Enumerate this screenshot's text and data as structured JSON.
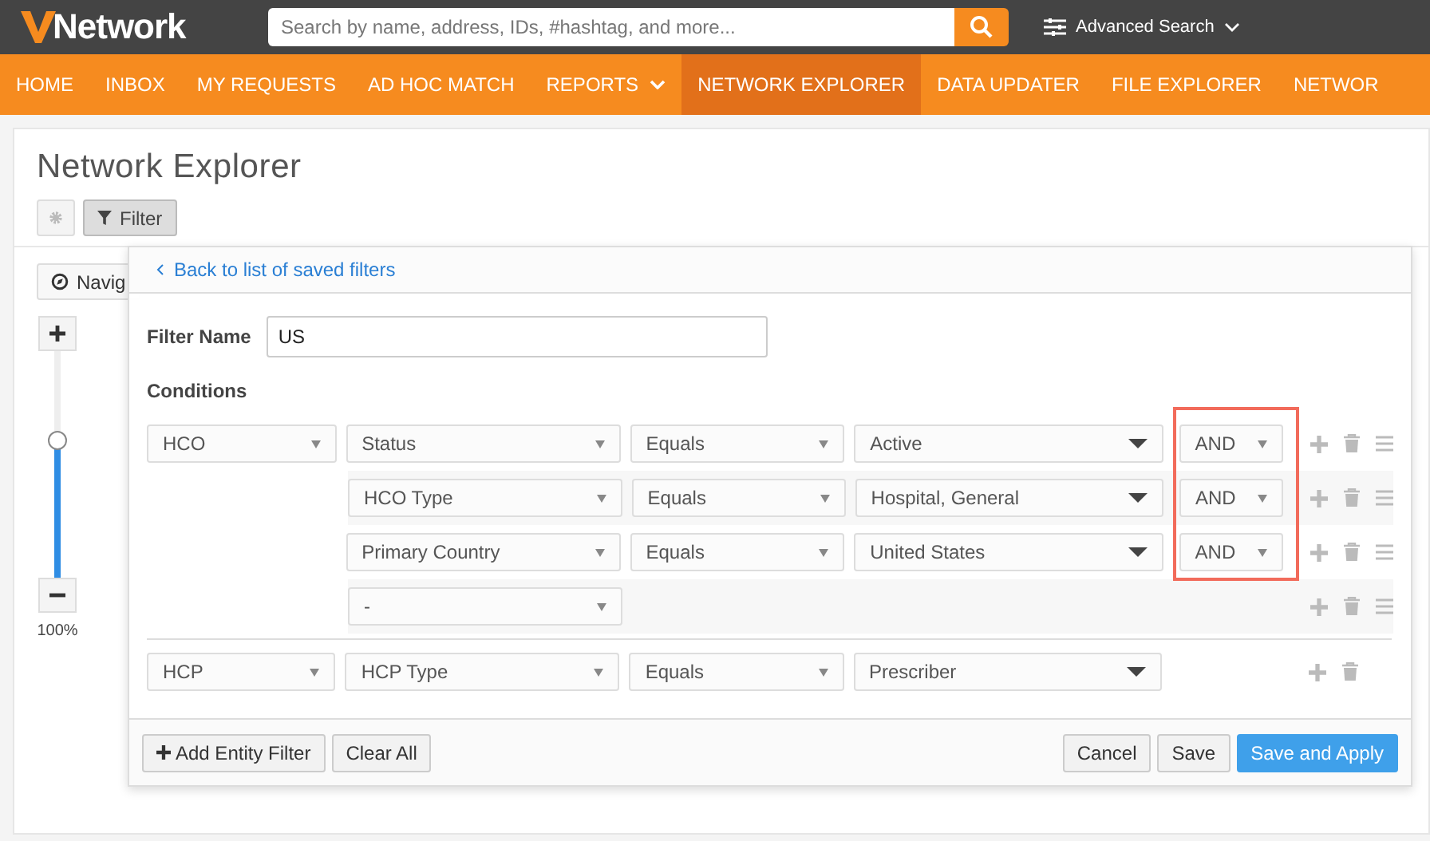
{
  "header": {
    "logo_text": "Network",
    "search": {
      "placeholder": "Search by name, address, IDs, #hashtag, and more..."
    },
    "advanced_search": "Advanced Search"
  },
  "nav": [
    {
      "label": "HOME",
      "selected": false,
      "dropdown": false
    },
    {
      "label": "INBOX",
      "selected": false,
      "dropdown": false
    },
    {
      "label": "MY REQUESTS",
      "selected": false,
      "dropdown": false
    },
    {
      "label": "AD HOC MATCH",
      "selected": false,
      "dropdown": false
    },
    {
      "label": "REPORTS",
      "selected": false,
      "dropdown": true
    },
    {
      "label": "NETWORK EXPLORER",
      "selected": true,
      "dropdown": false
    },
    {
      "label": "DATA UPDATER",
      "selected": false,
      "dropdown": false
    },
    {
      "label": "FILE EXPLORER",
      "selected": false,
      "dropdown": false
    },
    {
      "label": "NETWOR",
      "selected": false,
      "dropdown": false
    }
  ],
  "page": {
    "title": "Network Explorer",
    "filter_button": {
      "label": "Filter",
      "selected": true
    },
    "navigator_button": "Navig",
    "zoom": {
      "level": 0.6,
      "reading": "100%"
    }
  },
  "filter_panel": {
    "back_link": "Back to list of saved filters",
    "filter_name": {
      "label": "Filter Name",
      "value": "US"
    },
    "conditions_label": "Conditions",
    "logic_highlighted": true,
    "groups": [
      {
        "entity": "HCO",
        "draggable": true,
        "conditions": [
          {
            "field": "Status",
            "operator": "Equals",
            "value": "Active",
            "logic": "AND"
          },
          {
            "field": "HCO Type",
            "operator": "Equals",
            "value": "Hospital, General",
            "logic": "AND"
          },
          {
            "field": "Primary Country",
            "operator": "Equals",
            "value": "United States",
            "logic": "AND"
          },
          {
            "field": "-"
          }
        ]
      },
      {
        "entity": "HCP",
        "draggable": false,
        "conditions": [
          {
            "field": "HCP Type",
            "operator": "Equals",
            "value": "Prescriber"
          }
        ]
      }
    ],
    "buttons": [
      {
        "label": "Add Entity Filter",
        "kind": "add"
      },
      {
        "label": "Clear All",
        "kind": "plain"
      },
      {
        "label": "Cancel",
        "kind": "plain"
      },
      {
        "label": "Save",
        "kind": "plain"
      },
      {
        "label": "Save and Apply",
        "kind": "primary"
      }
    ]
  }
}
